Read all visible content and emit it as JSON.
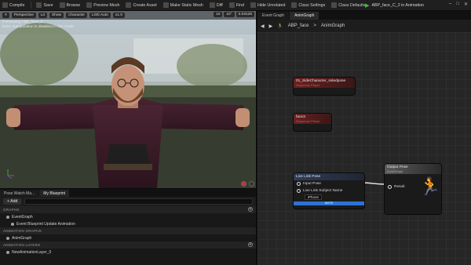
{
  "toolbar": {
    "compile": "Compile",
    "save": "Save",
    "browse": "Browse",
    "preview_mesh": "Preview Mesh",
    "create_asset": "Create Asset",
    "make_static_mesh": "Make Static Mesh",
    "diff": "Diff",
    "find": "Find",
    "hide_unrelated": "Hide Unrelated",
    "class_settings": "Class Settings",
    "class_defaults": "Class Defaults"
  },
  "window": {
    "tab_title": "ABP_face_C_2 in Animation"
  },
  "viewport": {
    "buttons": [
      "Perspective",
      "Lit",
      "Show",
      "Character",
      "LOD Auto",
      "x1.0"
    ],
    "right_buttons": [
      "10",
      "10°",
      "0.03125"
    ],
    "info_line1": "Previewing ABP_face_C",
    "info_line2": "Bone manipulation is disabled in this mode."
  },
  "left_panel": {
    "tabs": [
      "Pose Watch Ma...",
      "My Blueprint"
    ],
    "add_label": "+ Add",
    "sections": {
      "graphs": "GRAPHS",
      "animation_graphs": "ANIMATION GRAPHS",
      "animation_layers": "ANIMATION LAYERS"
    },
    "items": {
      "event_graph": "EventGraph",
      "event_update": "Event Blueprint Update Animation",
      "anim_graph": "AnimGraph",
      "new_layer": "NewAnimationLayer_0"
    }
  },
  "graph": {
    "tabs": [
      "Event Graph",
      "AnimGraph"
    ],
    "breadcrumb_root": "ABP_face",
    "breadcrumb_sep": ">",
    "breadcrumb_current": "AnimGraph",
    "nodes": {
      "seq1_title": "01_SideCharacter_sidedpose",
      "seq1_sub": "Sequence Player",
      "seq2_title": "face3",
      "seq2_sub": "Sequence Player",
      "livelink_title": "Live Link Pose",
      "livelink_input": "Input Pose",
      "livelink_subject": "Live Link Subject Name",
      "livelink_subject_value": "iPhone",
      "livelink_footer": "NOTE",
      "output_title": "Output Pose",
      "output_sub": "AnimGraph",
      "output_pin": "Result"
    }
  },
  "colors": {
    "accent_blue": "#2d72d6",
    "play_green": "#3fbf3f"
  }
}
